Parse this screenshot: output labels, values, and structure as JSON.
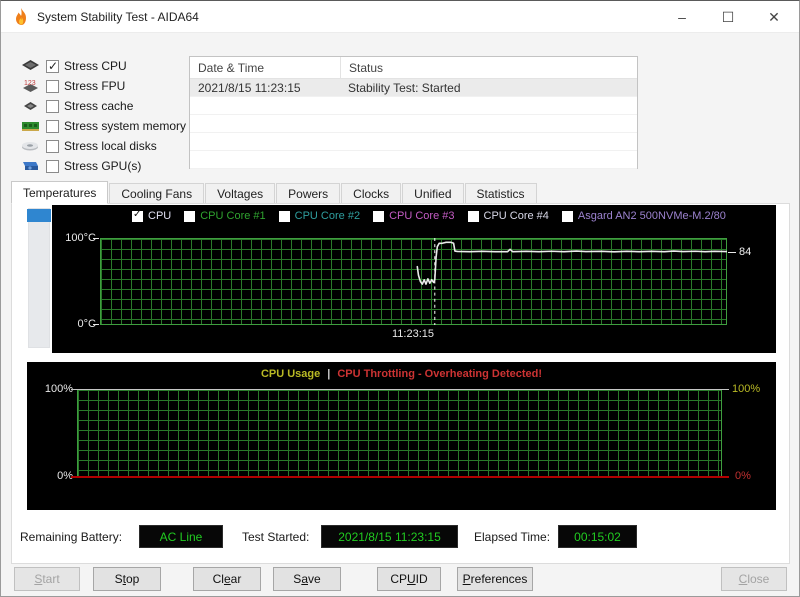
{
  "window": {
    "title": "System Stability Test - AIDA64",
    "controls": {
      "minimize": "–",
      "maximize": "☐",
      "close": "✕"
    }
  },
  "stress_options": [
    {
      "label": "Stress CPU",
      "checked": true,
      "icon": "cpu-icon"
    },
    {
      "label": "Stress FPU",
      "checked": false,
      "icon": "fpu-icon"
    },
    {
      "label": "Stress cache",
      "checked": false,
      "icon": "cache-icon"
    },
    {
      "label": "Stress system memory",
      "checked": false,
      "icon": "memory-icon"
    },
    {
      "label": "Stress local disks",
      "checked": false,
      "icon": "disk-icon"
    },
    {
      "label": "Stress GPU(s)",
      "checked": false,
      "icon": "gpu-icon"
    }
  ],
  "log": {
    "columns": [
      "Date & Time",
      "Status"
    ],
    "rows": [
      [
        "2021/8/15 11:23:15",
        "Stability Test: Started"
      ]
    ]
  },
  "tabs": [
    {
      "label": "Temperatures",
      "active": true
    },
    {
      "label": "Cooling Fans",
      "active": false
    },
    {
      "label": "Voltages",
      "active": false
    },
    {
      "label": "Powers",
      "active": false
    },
    {
      "label": "Clocks",
      "active": false
    },
    {
      "label": "Unified",
      "active": false
    },
    {
      "label": "Statistics",
      "active": false
    }
  ],
  "temperature_panel": {
    "legend": [
      {
        "label": "CPU",
        "color": "#e2e2f4",
        "checked": true
      },
      {
        "label": "CPU Core #1",
        "color": "#2fa32f",
        "checked": false
      },
      {
        "label": "CPU Core #2",
        "color": "#2f9f9f",
        "checked": false
      },
      {
        "label": "CPU Core #3",
        "color": "#c45cc4",
        "checked": false
      },
      {
        "label": "CPU Core #4",
        "color": "#d8d8e8",
        "checked": false
      },
      {
        "label": "Asgard AN2 500NVMe-M.2/80",
        "color": "#9c82cf",
        "checked": false
      }
    ],
    "y_max_label": "100°C",
    "y_min_label": "0°C",
    "current_value": "84",
    "time_marker_label": "11:23:15"
  },
  "usage_panel": {
    "title": "CPU Usage",
    "separator": "|",
    "alert": "CPU Throttling - Overheating Detected!",
    "left_top": "100%",
    "left_bottom": "0%",
    "right_top": "100%",
    "right_bottom": "0%",
    "title_color": "#b9b925",
    "alert_color": "#cc3333"
  },
  "status_bar": {
    "battery_label": "Remaining Battery:",
    "battery_value": "AC Line",
    "started_label": "Test Started:",
    "started_value": "2021/8/15 11:23:15",
    "elapsed_label": "Elapsed Time:",
    "elapsed_value": "00:15:02"
  },
  "buttons": [
    {
      "label": "Start",
      "mnemonic": 0,
      "disabled": true
    },
    {
      "label": "Stop",
      "mnemonic": 1,
      "disabled": false
    },
    {
      "label": "Clear",
      "mnemonic": 2,
      "disabled": false
    },
    {
      "label": "Save",
      "mnemonic": 1,
      "disabled": false
    },
    {
      "label": "CPUID",
      "mnemonic": 2,
      "disabled": false
    },
    {
      "label": "Preferences",
      "mnemonic": 0,
      "disabled": false
    },
    {
      "label": "Close",
      "mnemonic": 0,
      "disabled": true
    }
  ],
  "chart_data": [
    {
      "type": "line",
      "title": "Temperatures",
      "ylabel": "°C",
      "ylim": [
        0,
        100
      ],
      "y_tick_labels": [
        "100°C",
        "0°C"
      ],
      "legend_position": "top",
      "grid": true,
      "time_marker": {
        "label": "11:23:15",
        "x_frac": 0.534
      },
      "series": [
        {
          "name": "CPU",
          "color": "#eaeaea",
          "end_value": 84,
          "points": [
            [
              0.506,
              67
            ],
            [
              0.508,
              57
            ],
            [
              0.511,
              50
            ],
            [
              0.514,
              47
            ],
            [
              0.517,
              52
            ],
            [
              0.52,
              47
            ],
            [
              0.523,
              53
            ],
            [
              0.526,
              48
            ],
            [
              0.529,
              52
            ],
            [
              0.532,
              49
            ],
            [
              0.534,
              52
            ],
            [
              0.536,
              78
            ],
            [
              0.538,
              90
            ],
            [
              0.541,
              94
            ],
            [
              0.546,
              94
            ],
            [
              0.552,
              95
            ],
            [
              0.56,
              95
            ],
            [
              0.564,
              94
            ],
            [
              0.566,
              85
            ],
            [
              0.57,
              84.5
            ],
            [
              0.59,
              84.3
            ],
            [
              0.61,
              84.6
            ],
            [
              0.63,
              84.3
            ],
            [
              0.65,
              84.3
            ],
            [
              0.654,
              87
            ],
            [
              0.658,
              84.3
            ],
            [
              0.68,
              84.6
            ],
            [
              0.7,
              84.3
            ],
            [
              0.72,
              84.8
            ],
            [
              0.74,
              84.3
            ],
            [
              0.76,
              85
            ],
            [
              0.775,
              84.4
            ],
            [
              0.8,
              84.6
            ],
            [
              0.82,
              84.2
            ],
            [
              0.84,
              84.7
            ],
            [
              0.86,
              84.3
            ],
            [
              0.88,
              84.6
            ],
            [
              0.9,
              84.3
            ],
            [
              0.915,
              85
            ],
            [
              0.93,
              84.4
            ],
            [
              0.95,
              84.8
            ],
            [
              0.965,
              84.3
            ],
            [
              0.98,
              84.6
            ],
            [
              1.0,
              84.4
            ]
          ]
        }
      ]
    },
    {
      "type": "line",
      "title": "CPU Usage",
      "annotation": "CPU Throttling - Overheating Detected!",
      "ylabel": "%",
      "ylim": [
        0,
        100
      ],
      "y_tick_labels": [
        "100%",
        "0%"
      ],
      "grid": true,
      "series": [
        {
          "name": "CPU Throttling",
          "color": "#b30000",
          "points": [
            [
              0,
              0
            ],
            [
              1,
              0
            ]
          ]
        }
      ]
    }
  ]
}
